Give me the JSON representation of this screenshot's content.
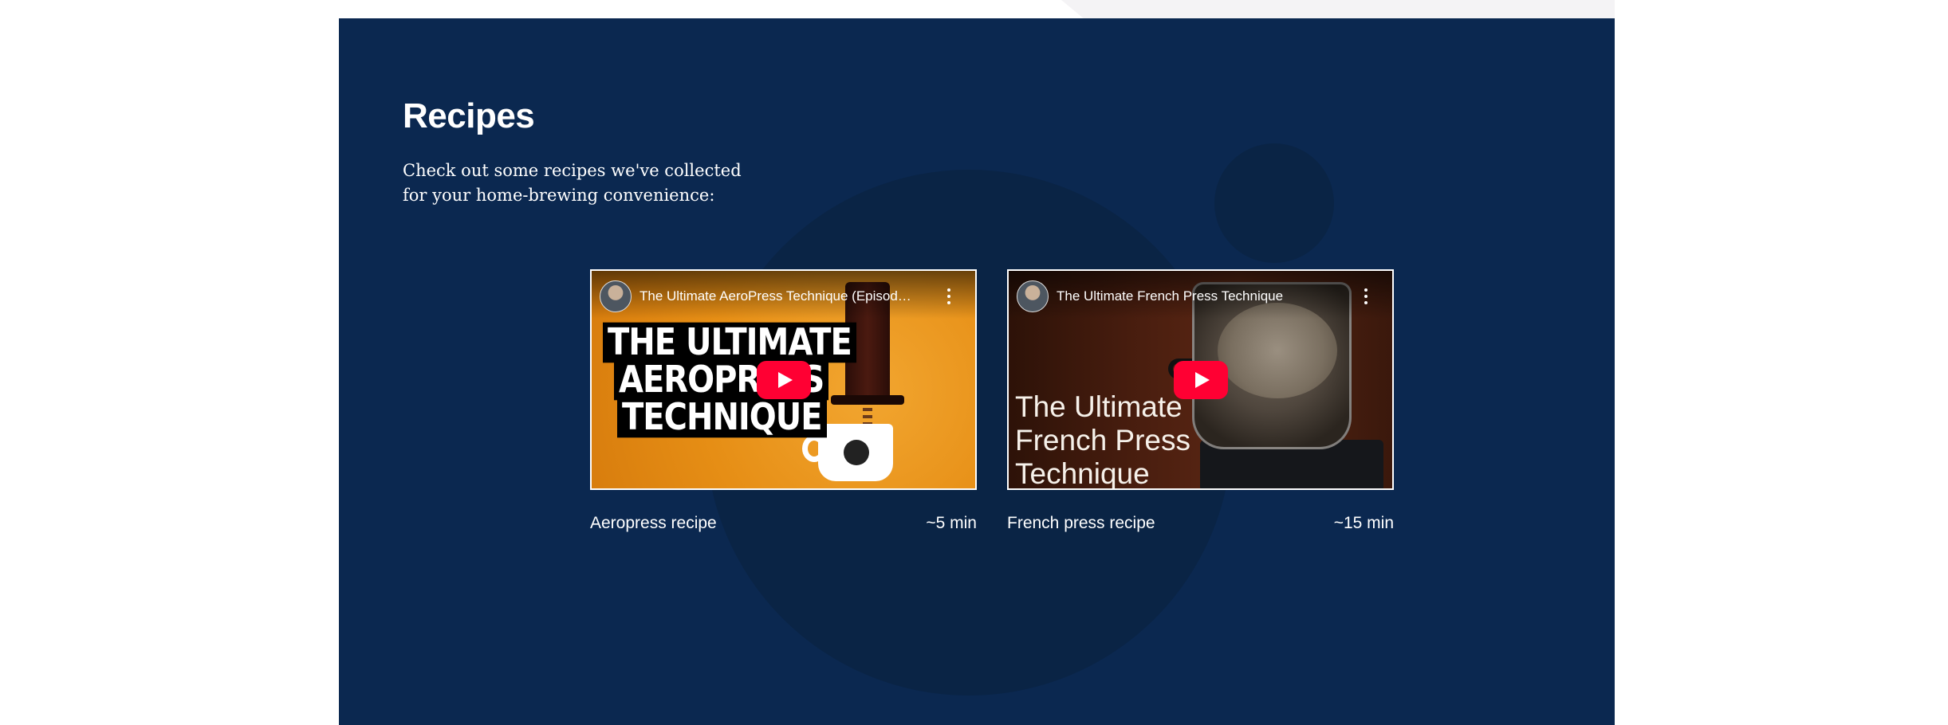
{
  "section": {
    "heading": "Recipes",
    "intro": "Check out some recipes we've collected for your home-brewing convenience:",
    "colors": {
      "background": "#0b2850",
      "decor": "#0a2445",
      "text": "#ffffff",
      "play_button": "#ff0033"
    }
  },
  "recipes": [
    {
      "video_title": "The Ultimate AeroPress Technique (Episod…",
      "thumbnail_text": [
        "THE ULTIMATE",
        "AEROPRESS",
        "TECHNIQUE"
      ],
      "name": "Aeropress recipe",
      "duration": "~5 min"
    },
    {
      "video_title": "The Ultimate French Press Technique",
      "thumbnail_text": "The Ultimate French Press Technique",
      "name": "French press recipe",
      "duration": "~15 min"
    }
  ],
  "icons": {
    "play": "play-icon",
    "more": "more-vert-icon",
    "channel": "channel-avatar-icon"
  }
}
